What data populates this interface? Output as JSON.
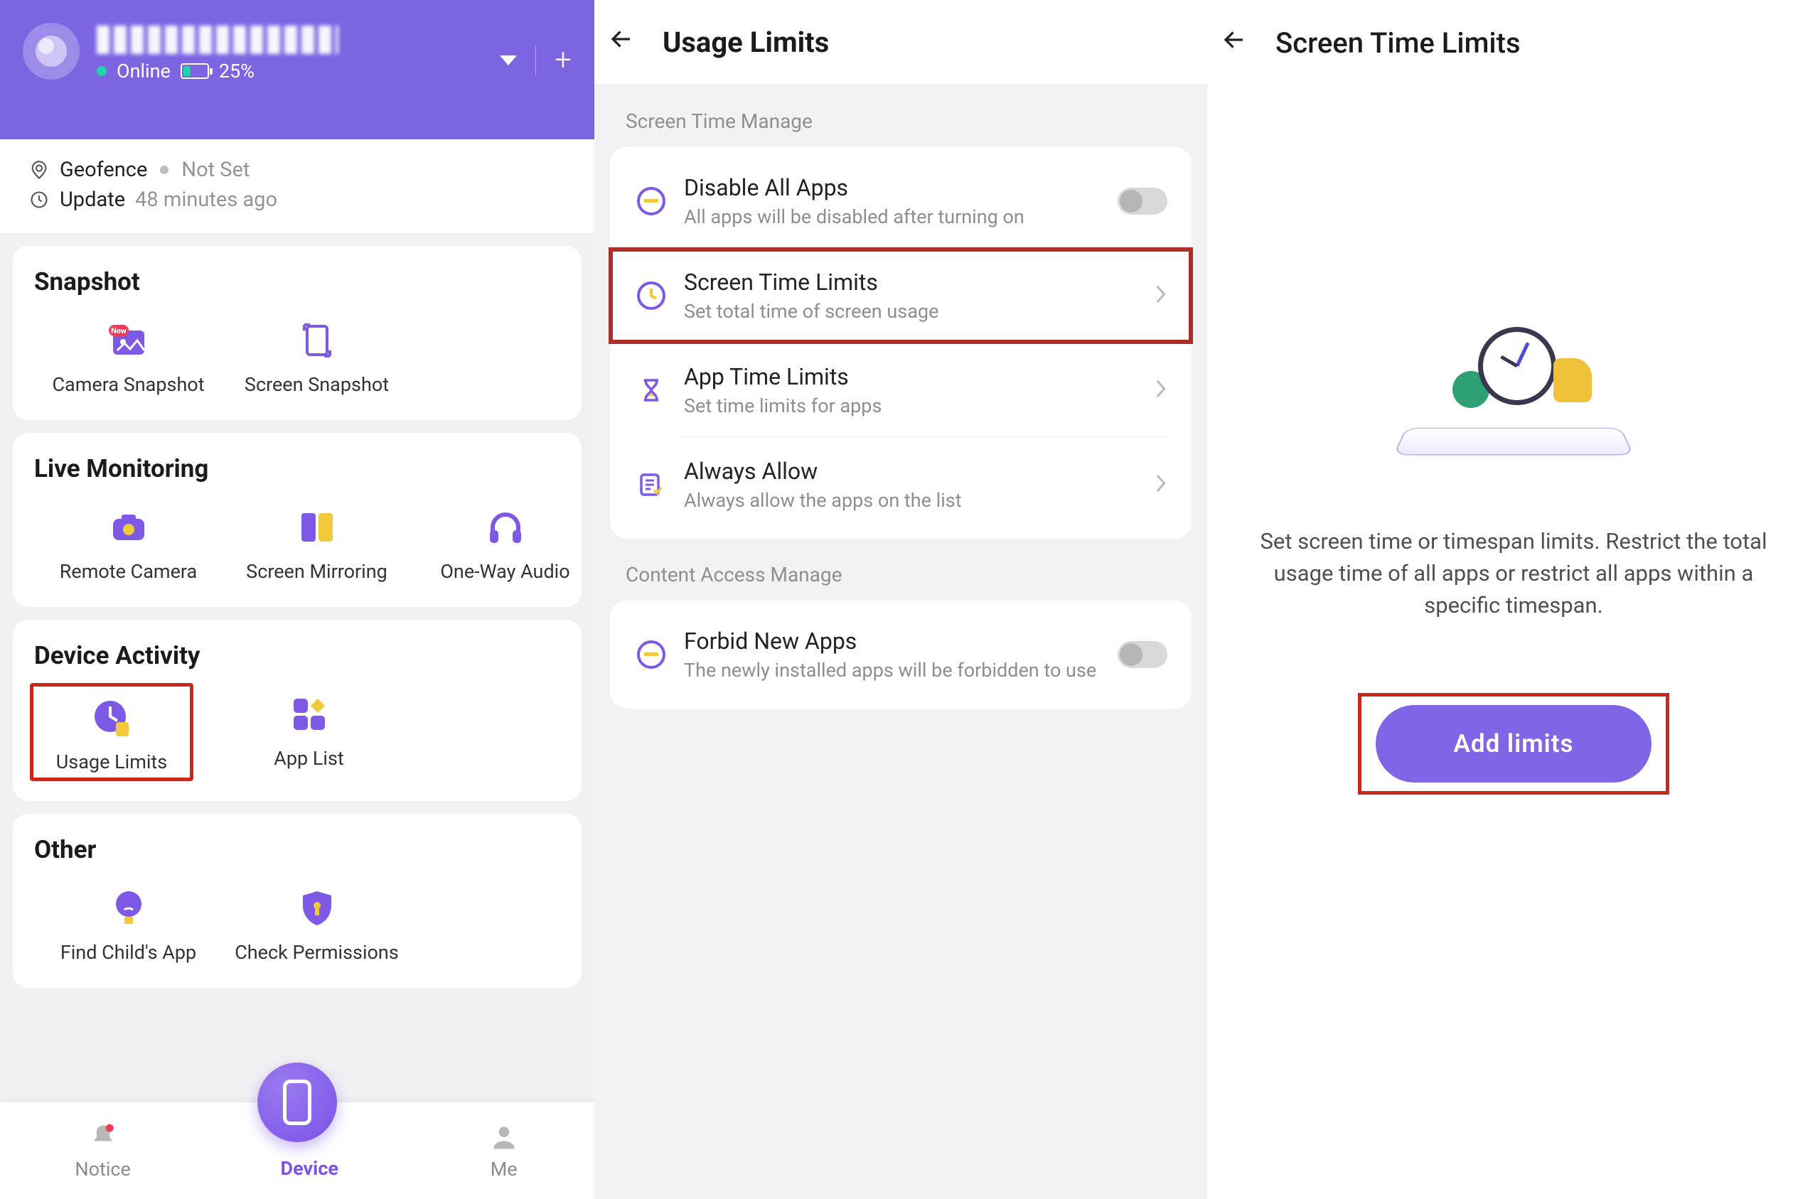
{
  "panel1": {
    "status_online": "Online",
    "battery": "25%",
    "geofence_label": "Geofence",
    "geofence_value": "Not Set",
    "update_label": "Update",
    "update_value": "48 minutes ago",
    "sections": {
      "snapshot": {
        "title": "Snapshot",
        "tiles": [
          {
            "label": "Camera Snapshot"
          },
          {
            "label": "Screen Snapshot"
          }
        ]
      },
      "live": {
        "title": "Live Monitoring",
        "tiles": [
          {
            "label": "Remote Camera"
          },
          {
            "label": "Screen Mirroring"
          },
          {
            "label": "One-Way Audio"
          }
        ]
      },
      "activity": {
        "title": "Device Activity",
        "tiles": [
          {
            "label": "Usage Limits"
          },
          {
            "label": "App List"
          }
        ]
      },
      "other": {
        "title": "Other",
        "tiles": [
          {
            "label": "Find Child's App"
          },
          {
            "label": "Check Permissions"
          }
        ]
      }
    },
    "nav": {
      "notice": "Notice",
      "device": "Device",
      "me": "Me"
    }
  },
  "panel2": {
    "title": "Usage Limits",
    "section1": "Screen Time Manage",
    "section2": "Content Access Manage",
    "rows": {
      "disable_all": {
        "title": "Disable All Apps",
        "sub": "All apps will be disabled after turning on"
      },
      "screen_time": {
        "title": "Screen Time Limits",
        "sub": "Set total time of screen usage"
      },
      "app_time": {
        "title": "App Time Limits",
        "sub": "Set time limits for apps"
      },
      "always_allow": {
        "title": "Always Allow",
        "sub": "Always allow the apps on the list"
      },
      "forbid_new": {
        "title": "Forbid New Apps",
        "sub": "The newly installed apps will be forbidden to use"
      }
    }
  },
  "panel3": {
    "title": "Screen Time Limits",
    "body": "Set screen time or timespan limits. Restrict the total usage time of all apps or restrict all apps within a specific timespan.",
    "button": "Add limits"
  }
}
